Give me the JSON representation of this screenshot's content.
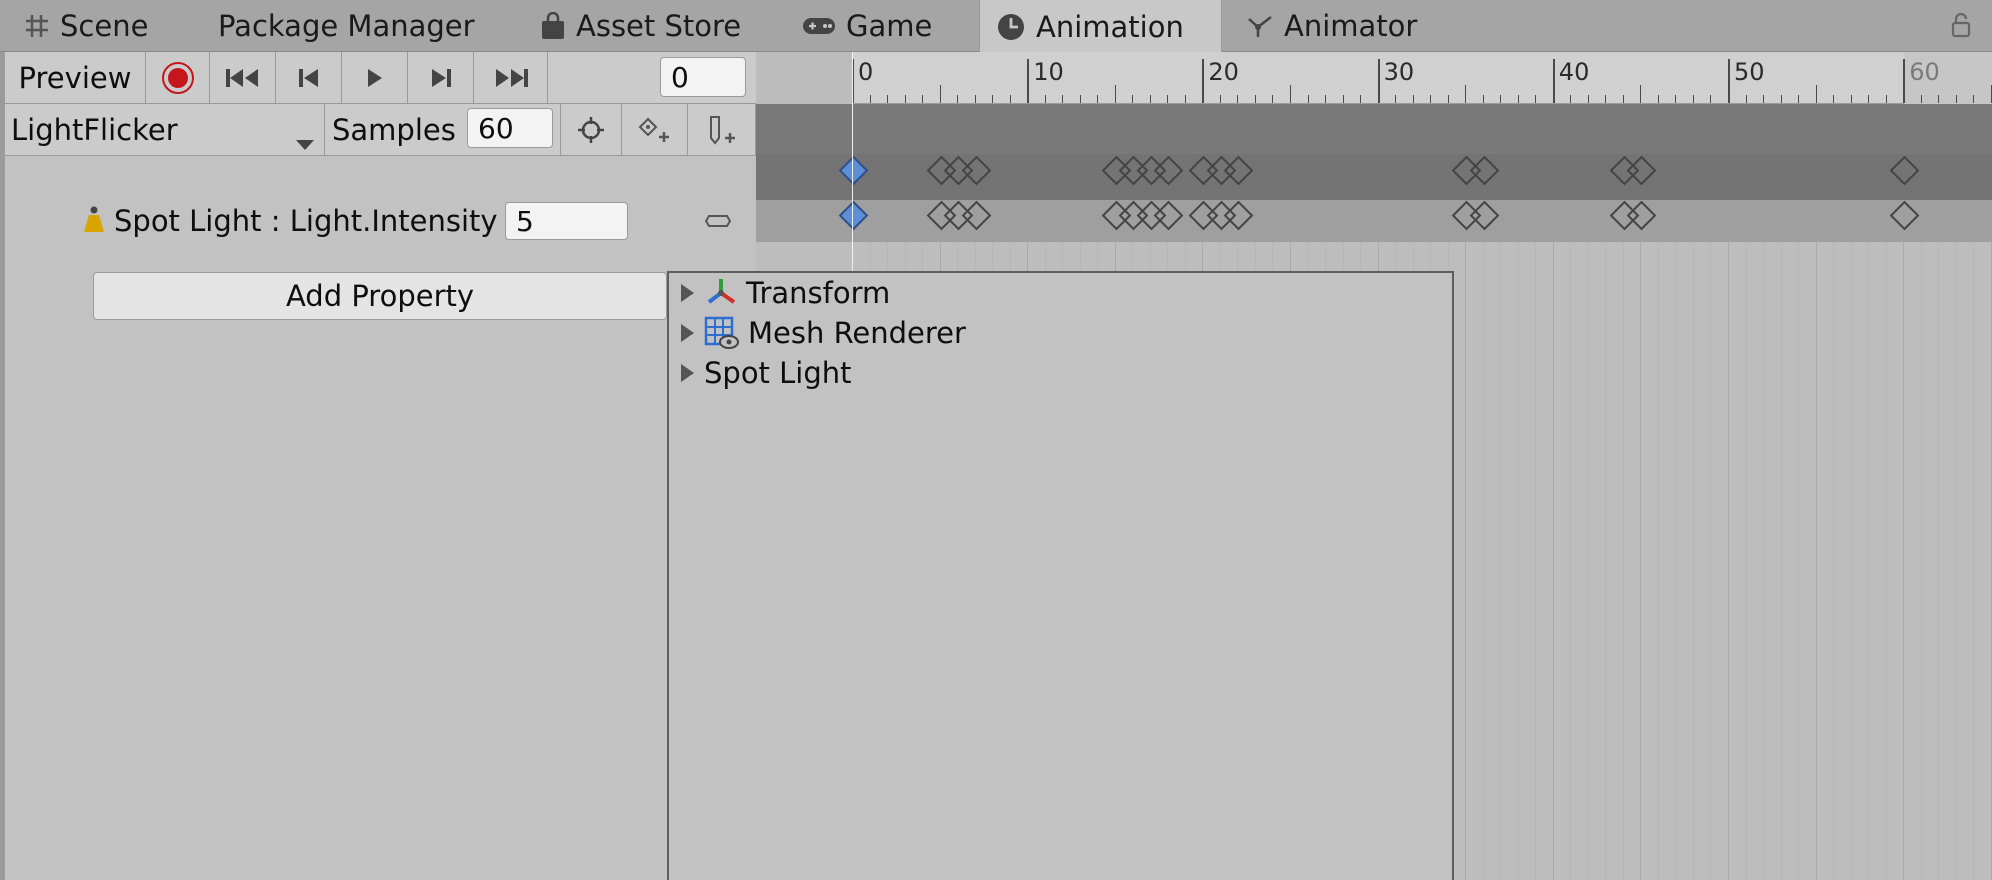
{
  "tabs": [
    {
      "label": "Scene",
      "icon": "grid-icon"
    },
    {
      "label": "Package Manager",
      "icon": ""
    },
    {
      "label": "Asset Store",
      "icon": "shopping-bag-icon"
    },
    {
      "label": "Game",
      "icon": "gamepad-icon"
    },
    {
      "label": "Animation",
      "icon": "clock-icon",
      "active": true
    },
    {
      "label": "Animator",
      "icon": "animator-icon"
    }
  ],
  "toolbar": {
    "preview_label": "Preview",
    "frame_value": "0",
    "clip_name": "LightFlicker",
    "samples_label": "Samples",
    "samples_value": "60"
  },
  "property": {
    "label": "Spot Light : Light.Intensity",
    "value": "5"
  },
  "add_property_label": "Add Property",
  "popup_items": [
    {
      "label": "Transform",
      "icon": "transform-icon"
    },
    {
      "label": "Mesh Renderer",
      "icon": "mesh-renderer-icon"
    },
    {
      "label": "Spot Light",
      "icon": ""
    }
  ],
  "ruler_labels": [
    "0",
    "10",
    "20",
    "30",
    "40",
    "50",
    "60"
  ],
  "colors": {
    "record": "#c4161c",
    "selected_key": "#5e8fd6",
    "spot_light_icon": "#d9a300"
  }
}
